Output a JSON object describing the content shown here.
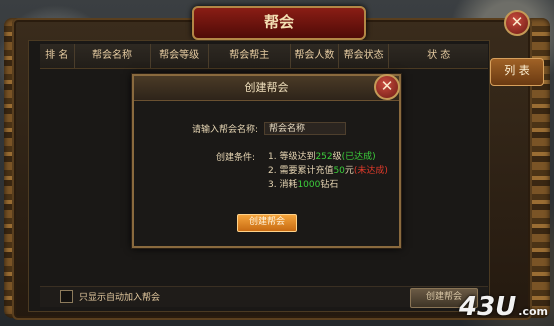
{
  "window": {
    "title": "帮会"
  },
  "side_tab": {
    "label": "列 表"
  },
  "table": {
    "columns": [
      "排 名",
      "帮会名称",
      "帮会等级",
      "帮会帮主",
      "帮会人数",
      "帮会状态",
      "状 态"
    ]
  },
  "footer": {
    "auto_join_label": "只显示自动加入帮会",
    "create_button_label": "创建帮会"
  },
  "dialog": {
    "title": "创建帮会",
    "name_label": "请输入帮会名称:",
    "name_value": "帮会名称",
    "conditions_label": "创建条件:",
    "conditions": [
      {
        "prefix": "1. 等级达到",
        "value": "252",
        "suffix": "级",
        "status": "(已达成)"
      },
      {
        "prefix": "2. 需要累计充值",
        "value": "50",
        "suffix": "元",
        "status": "(未达成)"
      },
      {
        "prefix": "3. 消耗",
        "value": "1000",
        "suffix": "钻石",
        "status": ""
      }
    ],
    "create_button_label": "创建帮会"
  },
  "watermark": {
    "text": "43U",
    "suffix": ".com"
  },
  "icons": {
    "close": "close-icon"
  },
  "colors": {
    "achieved": "#3ccf3c",
    "not_achieved": "#e23a2a",
    "button_orange": "#e8871f"
  }
}
